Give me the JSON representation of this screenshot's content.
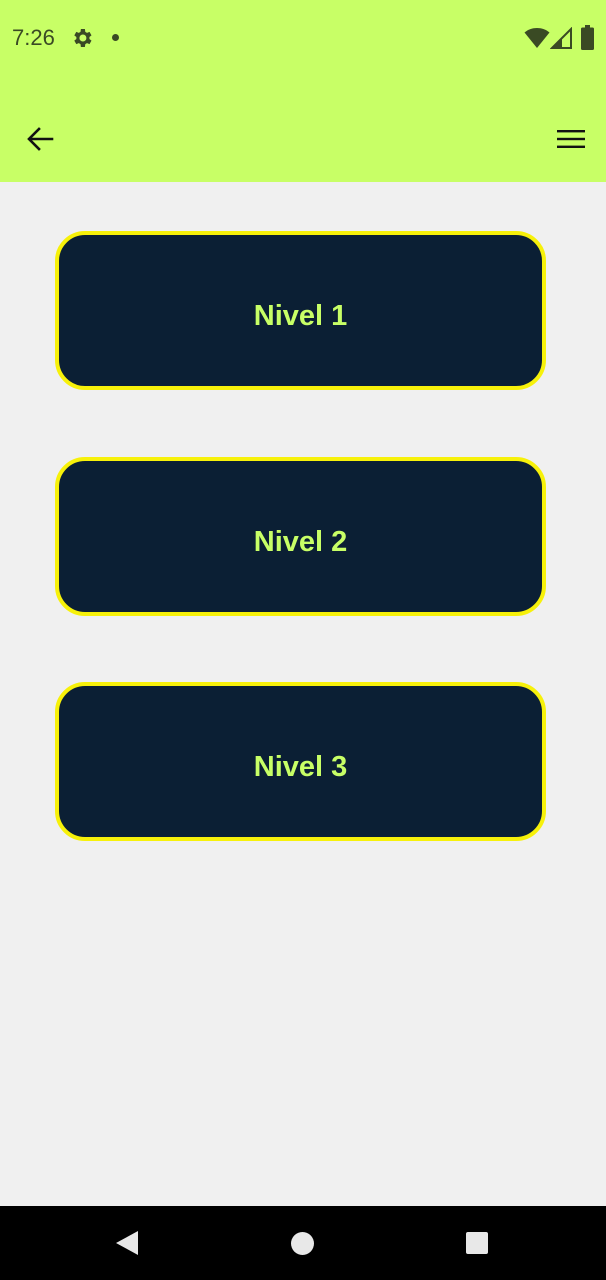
{
  "status_bar": {
    "time": "7:26",
    "icons": [
      "gear-icon",
      "notification-dot-icon",
      "wifi-icon",
      "signal-icon",
      "battery-icon"
    ]
  },
  "app_bar": {
    "background": "#c8ff66",
    "icons": [
      "arrow-left-icon",
      "hamburger-menu-icon"
    ]
  },
  "levels": [
    {
      "label": "Nivel 1"
    },
    {
      "label": "Nivel 2"
    },
    {
      "label": "Nivel 3"
    }
  ],
  "colors": {
    "button_background": "#0b1f34",
    "button_border": "#f7f10a",
    "button_text": "#c8ff66",
    "page_background": "#f0f0f0"
  },
  "nav_bar": {
    "icons": [
      "nav-back-icon",
      "nav-home-icon",
      "nav-recents-icon"
    ]
  }
}
